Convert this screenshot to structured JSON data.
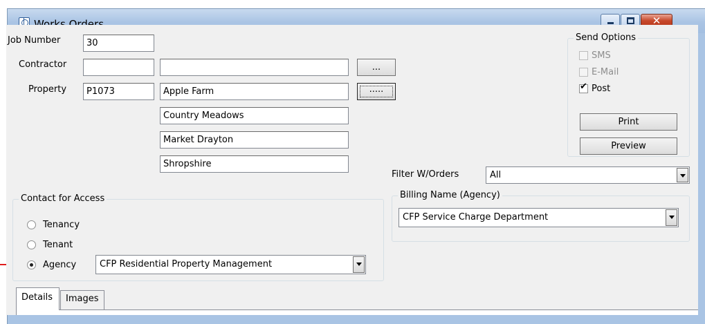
{
  "window": {
    "title": "Works Orders"
  },
  "form": {
    "job_number_label": "Job Number",
    "job_number_value": "30",
    "contractor_label": "Contractor",
    "contractor_code": "",
    "contractor_name": "",
    "contractor_lookup": "...",
    "property_label": "Property",
    "property_code": "P1073",
    "property_lookup": ".....",
    "address": [
      "Apple Farm",
      "Country Meadows",
      "Market Drayton",
      "Shropshire"
    ]
  },
  "send_options": {
    "title": "Send Options",
    "sms_label": "SMS",
    "email_label": "E-Mail",
    "post_label": "Post",
    "post_checked": true,
    "print_label": "Print",
    "preview_label": "Preview"
  },
  "filter": {
    "label": "Filter W/Orders",
    "value": "All"
  },
  "billing": {
    "title": "Billing Name (Agency)",
    "value": "CFP Service Charge Department"
  },
  "contact": {
    "title": "Contact for Access",
    "tenancy_label": "Tenancy",
    "tenant_label": "Tenant",
    "agency_label": "Agency",
    "selected": "Agency",
    "agency_value": "CFP Residential Property Management"
  },
  "tabs": [
    "Details",
    "Images"
  ],
  "colors": {
    "annotation_arrow": "#e01b1b",
    "titlebar": "#aac4e4",
    "close_button": "#c7482b"
  }
}
